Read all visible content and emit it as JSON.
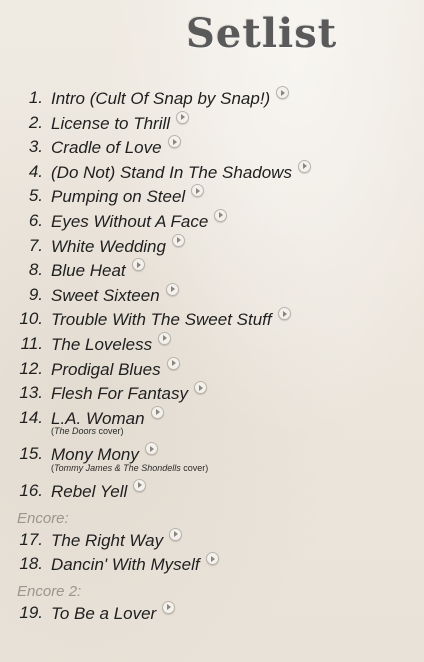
{
  "title": "Setlist",
  "songs": [
    {
      "num": "1.",
      "title": "Intro (Cult Of Snap by Snap!)"
    },
    {
      "num": "2.",
      "title": "License to Thrill"
    },
    {
      "num": "3.",
      "title": "Cradle of Love"
    },
    {
      "num": "4.",
      "title": "(Do Not) Stand In The Shadows"
    },
    {
      "num": "5.",
      "title": "Pumping on Steel"
    },
    {
      "num": "6.",
      "title": "Eyes Without A Face"
    },
    {
      "num": "7.",
      "title": "White Wedding"
    },
    {
      "num": "8.",
      "title": "Blue Heat"
    },
    {
      "num": "9.",
      "title": "Sweet Sixteen"
    },
    {
      "num": "10.",
      "title": "Trouble With The Sweet Stuff"
    },
    {
      "num": "11.",
      "title": "The Loveless"
    },
    {
      "num": "12.",
      "title": "Prodigal Blues"
    },
    {
      "num": "13.",
      "title": "Flesh For Fantasy"
    },
    {
      "num": "14.",
      "title": "L.A. Woman",
      "note_artist": "The Doors",
      "note_suffix": " cover"
    },
    {
      "num": "15.",
      "title": "Mony Mony",
      "note_artist": "Tommy James & The Shondells",
      "note_suffix": " cover"
    },
    {
      "num": "16.",
      "title": "Rebel Yell"
    },
    {
      "num": "17.",
      "title": "The Right Way"
    },
    {
      "num": "18.",
      "title": "Dancin' With Myself"
    },
    {
      "num": "19.",
      "title": "To Be a Lover"
    }
  ],
  "encores": {
    "encore1": "Encore:",
    "encore2": "Encore 2:"
  },
  "note_open": "(",
  "note_close": ")",
  "play_icon": "play-circle-icon"
}
